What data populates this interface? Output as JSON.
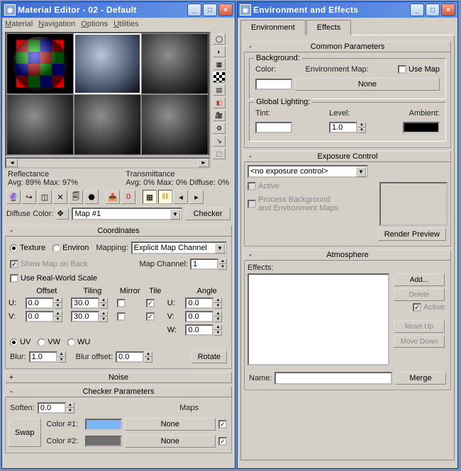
{
  "left_window": {
    "title": "Material Editor - 02 - Default",
    "menu": {
      "m1": "Material",
      "m2": "Navigation",
      "m3": "Options",
      "m4": "Utilities"
    },
    "stats": {
      "reflectance_label": "Reflectance",
      "reflectance_val": "Avg:  89% Max:  97%",
      "transmittance_label": "Transmittance",
      "transmittance_val": "Avg:   0% Max:   0% Diffuse:   0%"
    },
    "diffuse_label": "Diffuse Color:",
    "map_name": "Map #1",
    "checker_btn": "Checker",
    "rollups": {
      "coords_title": "Coordinates",
      "noise_title": "Noise",
      "checker_title": "Checker Parameters"
    },
    "coords": {
      "texture": "Texture",
      "environ": "Environ",
      "mapping_label": "Mapping:",
      "mapping_val": "Explicit Map Channel",
      "show_map": "Show Map on Back",
      "map_channel_label": "Map Channel:",
      "map_channel_val": "1",
      "real_world": "Use Real-World Scale",
      "hdr_offset": "Offset",
      "hdr_tiling": "Tiling",
      "hdr_mirror": "Mirror",
      "hdr_tile": "Tile",
      "hdr_angle": "Angle",
      "u_label": "U:",
      "v_label": "V:",
      "w_label": "W:",
      "u_off": "0.0",
      "v_off": "0.0",
      "u_til": "30.0",
      "v_til": "30.0",
      "u_ang": "0.0",
      "v_ang": "0.0",
      "w_ang": "0.0",
      "uv": "UV",
      "vw": "VW",
      "wu": "WU",
      "blur_label": "Blur:",
      "blur_val": "1.0",
      "bluroff_label": "Blur offset:",
      "bluroff_val": "0.0",
      "rotate_btn": "Rotate"
    },
    "checker": {
      "soften_label": "Soften:",
      "soften_val": "0.0",
      "maps_label": "Maps",
      "swap_btn": "Swap",
      "c1_label": "Color #1:",
      "c2_label": "Color #2:",
      "none": "None"
    }
  },
  "right_window": {
    "title": "Environment and Effects",
    "tab_env": "Environment",
    "tab_fx": "Effects",
    "rollups": {
      "common": "Common Parameters",
      "exposure": "Exposure Control",
      "atmos": "Atmosphere"
    },
    "bg": {
      "legend": "Background:",
      "color_label": "Color:",
      "envmap_label": "Environment Map:",
      "usemap_label": "Use Map",
      "none": "None"
    },
    "gl": {
      "legend": "Global Lighting:",
      "tint": "Tint:",
      "level": "Level:",
      "level_val": "1.0",
      "ambient": "Ambient:"
    },
    "exposure": {
      "dd": "<no exposure control>",
      "active": "Active",
      "process": "Process Background\nand Environment Maps",
      "render": "Render Preview"
    },
    "atmos": {
      "effects_label": "Effects:",
      "add": "Add...",
      "delete": "Delete",
      "active": "Active",
      "moveup": "Move Up",
      "movedown": "Move Down",
      "name_label": "Name:",
      "merge": "Merge"
    }
  }
}
